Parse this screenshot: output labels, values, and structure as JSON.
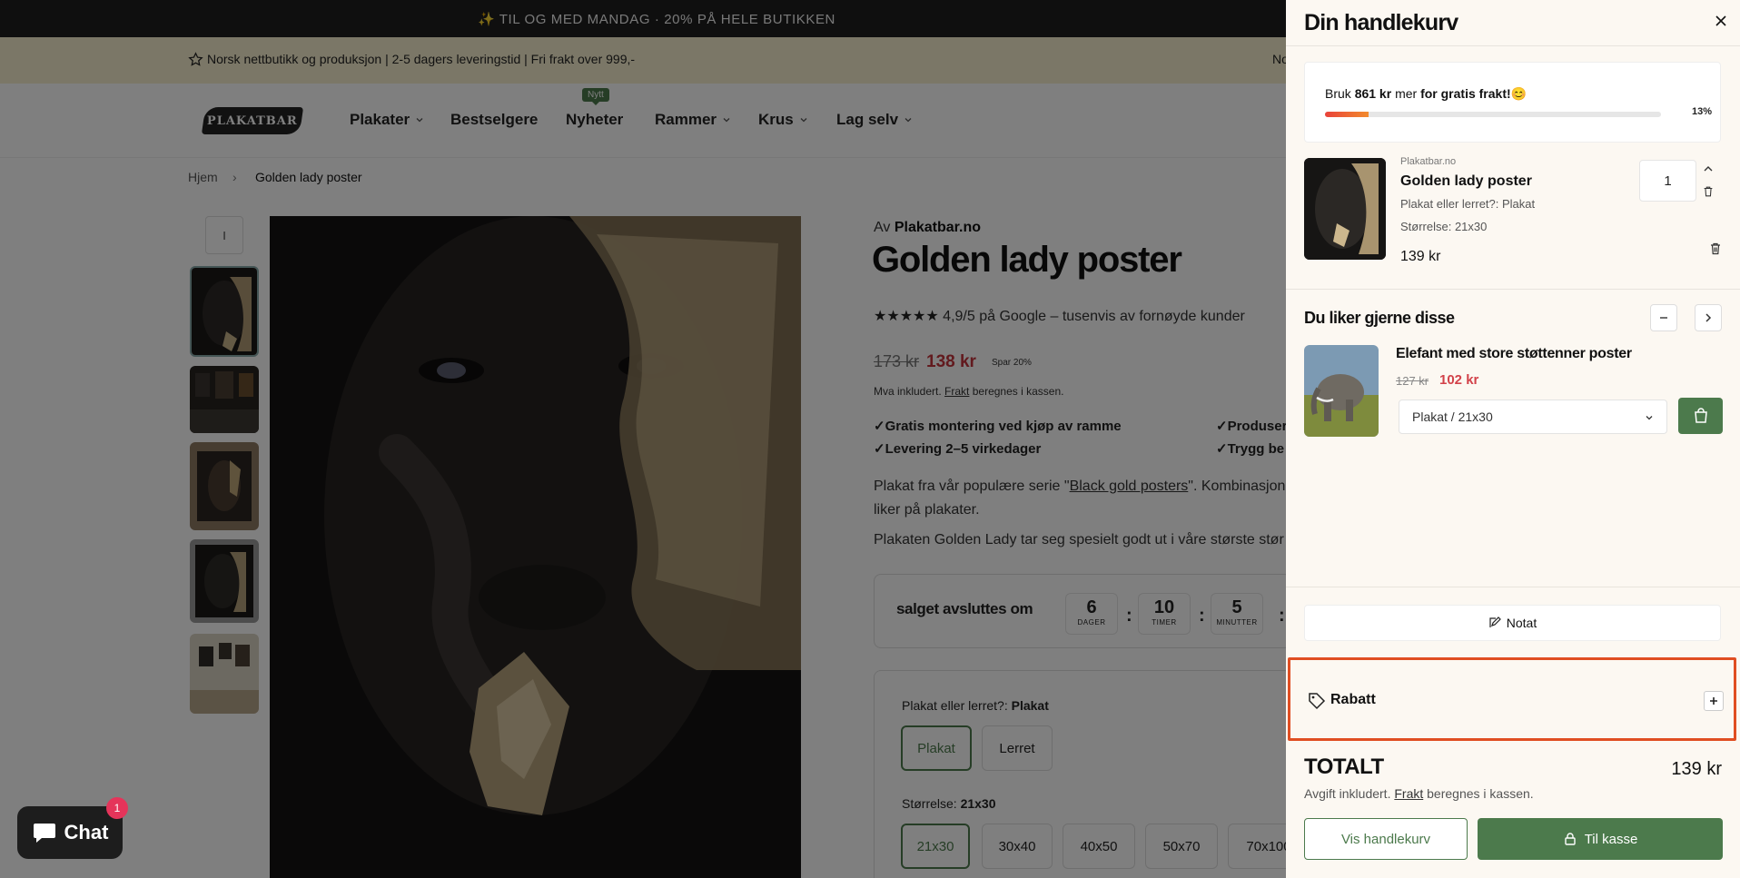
{
  "promo_bar": {
    "text": "✨ TIL OG MED MANDAG · 20% PÅ HELE BUTIKKEN"
  },
  "announcement": {
    "text": "Norsk nettbutikk og produksjon | 2-5 dagers leveringstid | Fri frakt over 999,-",
    "text_cut": "No"
  },
  "nav": {
    "logo": "PLAKATBAR",
    "items": [
      {
        "label": "Plakater"
      },
      {
        "label": "Bestselgere"
      },
      {
        "label": "Nyheter",
        "badge": "Nytt"
      },
      {
        "label": "Rammer"
      },
      {
        "label": "Krus"
      },
      {
        "label": "Lag selv"
      }
    ]
  },
  "breadcrumb": {
    "home": "Hjem",
    "separator": "›",
    "current": "Golden lady poster"
  },
  "gallery": {
    "nav_label": "I"
  },
  "product": {
    "by_prefix": "Av",
    "vendor": "Plakatbar.no",
    "title": "Golden lady poster",
    "stars": "★★★★★",
    "rating_text": "4,9/5 på Google – tusenvis av fornøyde kunder",
    "price_old": "173 kr",
    "price_new": "138 kr",
    "save": "Spar 20%",
    "tax_prefix": "Mva inkludert.",
    "tax_link": "Frakt",
    "tax_suffix": "beregnes i kassen.",
    "features": [
      "✓Gratis montering ved kjøp av ramme",
      "✓Levering 2–5 virkedager",
      "✓Produser",
      "✓Trygg be"
    ],
    "desc1_pre": "Plakat fra vår populære serie \"",
    "desc1_link": "Black gold posters",
    "desc1_post": "\". Kombinasjon",
    "desc1_line2": "liker på plakater.",
    "desc2": "Plakaten Golden Lady tar seg spesielt godt ut i våre største stør"
  },
  "countdown": {
    "label": "salget avsluttes om",
    "units": [
      {
        "value": "6",
        "label": "DAGER"
      },
      {
        "value": "10",
        "label": "TIMER"
      },
      {
        "value": "5",
        "label": "MINUTTER"
      }
    ],
    "separator": ":"
  },
  "options": {
    "type_label": "Plakat eller lerret?:",
    "type_value": "Plakat",
    "type_options": [
      "Plakat",
      "Lerret"
    ],
    "size_label": "Størrelse:",
    "size_value": "21x30",
    "size_options": [
      "21x30",
      "30x40",
      "40x50",
      "50x70",
      "70x100"
    ]
  },
  "chat": {
    "label": "Chat",
    "badge": "1"
  },
  "cart": {
    "title": "Din handlekurv",
    "free_shipping": {
      "prefix": "Bruk",
      "amount": "861 kr",
      "middle": "mer",
      "bold": "for gratis frakt!",
      "emoji": "😊",
      "percent_label": "13%",
      "progress": 0.13
    },
    "item": {
      "vendor": "Plakatbar.no",
      "name": "Golden lady poster",
      "option1": "Plakat eller lerret?: Plakat",
      "option2": "Størrelse: 21x30",
      "price": "139 kr",
      "quantity": "1"
    },
    "upsell": {
      "title": "Du liker gjerne disse",
      "name": "Elefant med store støttenner poster",
      "price_old": "127 kr",
      "price_new": "102 kr",
      "variant": "Plakat / 21x30"
    },
    "note_label": "Notat",
    "discount_label": "Rabatt",
    "total_label": "TOTALT",
    "total_value": "139 kr",
    "total_note_prefix": "Avgift inkludert.",
    "total_note_link": "Frakt",
    "total_note_suffix": "beregnes i kassen.",
    "view_cart": "Vis handlekurv",
    "checkout": "Til kasse"
  },
  "colors": {
    "accent_green": "#4c7a4c",
    "sale_red": "#c4353d",
    "highlight": "#e04e22"
  }
}
